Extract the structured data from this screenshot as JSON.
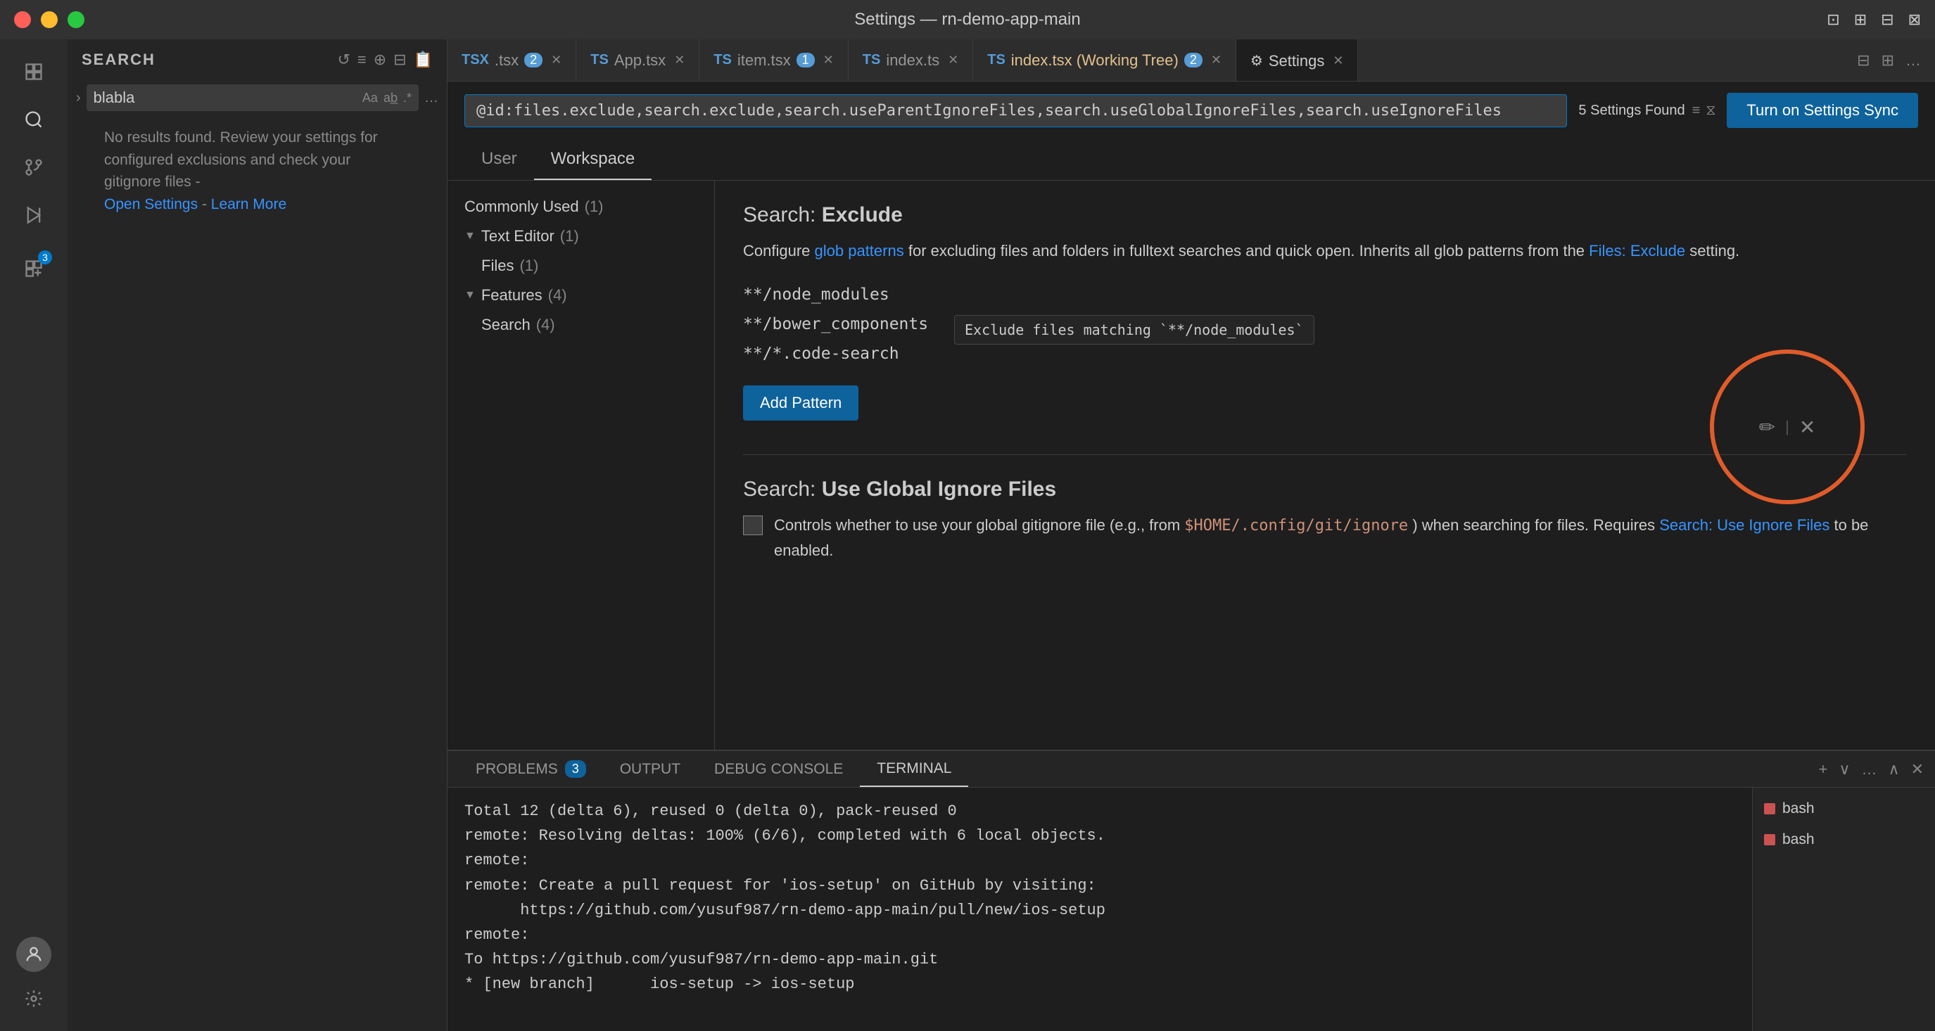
{
  "titleBar": {
    "title": "Settings — rn-demo-app-main",
    "icons": [
      "⊡",
      "⊞",
      "⊟",
      "⊠"
    ]
  },
  "activityBar": {
    "icons": [
      {
        "name": "explorer-icon",
        "symbol": "⧉",
        "active": false
      },
      {
        "name": "search-icon",
        "symbol": "🔍",
        "active": true
      },
      {
        "name": "source-control-icon",
        "symbol": "⑂",
        "active": false
      },
      {
        "name": "run-icon",
        "symbol": "▶",
        "active": false
      },
      {
        "name": "extensions-icon",
        "symbol": "⊞",
        "active": false,
        "badge": "3"
      }
    ],
    "bottomIcons": [
      {
        "name": "account-icon",
        "symbol": "👤"
      },
      {
        "name": "settings-gear-icon",
        "symbol": "⚙"
      }
    ]
  },
  "sidebar": {
    "title": "SEARCH",
    "headerIcons": [
      "↺",
      "≡",
      "⊕",
      "⊟",
      "📋"
    ],
    "searchValue": "blabla",
    "noResults": "No results found. Review your settings for configured exclusions and check your gitignore files -",
    "openSettings": "Open Settings",
    "learnMore": "Learn More",
    "chevron": "›"
  },
  "tabs": [
    {
      "label": ".tsx",
      "lang": "TSX",
      "badge": "2",
      "active": false,
      "modified": false
    },
    {
      "label": "App.tsx",
      "lang": "TS",
      "badge": null,
      "active": false,
      "modified": false
    },
    {
      "label": "item.tsx",
      "lang": "TS",
      "badge": "1",
      "active": false,
      "modified": false
    },
    {
      "label": "index.ts",
      "lang": "TS",
      "badge": null,
      "active": false,
      "modified": false
    },
    {
      "label": "index.tsx (Working Tree)",
      "lang": "TS",
      "badge": "2",
      "active": false,
      "modified": true
    },
    {
      "label": "Settings",
      "lang": null,
      "badge": null,
      "active": true,
      "modified": false
    }
  ],
  "settings": {
    "searchQuery": "@id:files.exclude,search.exclude,search.useParentIgnoreFiles,search.useGlobalIgnoreFiles,search.useIgnoreFiles",
    "foundCount": "5 Settings Found",
    "syncButton": "Turn on Settings Sync",
    "tabs": [
      {
        "label": "User",
        "active": false
      },
      {
        "label": "Workspace",
        "active": true
      }
    ],
    "tree": [
      {
        "label": "Commonly Used",
        "count": "(1)",
        "indent": 0,
        "chevron": null
      },
      {
        "label": "Text Editor",
        "count": "(1)",
        "indent": 0,
        "chevron": "▼"
      },
      {
        "label": "Files",
        "count": "(1)",
        "indent": 1,
        "chevron": null
      },
      {
        "label": "Features",
        "count": "(4)",
        "indent": 0,
        "chevron": "▼"
      },
      {
        "label": "Search",
        "count": "(4)",
        "indent": 1,
        "chevron": null
      }
    ],
    "mainSetting": {
      "title": "Search: ",
      "titleBold": "Exclude",
      "description": "Configure ",
      "descriptionLink1": "glob patterns",
      "descriptionMid": " for excluding files and folders in fulltext searches and quick open. Inherits all glob patterns from the ",
      "descriptionLink2": "Files: Exclude",
      "descriptionEnd": " setting.",
      "patterns": [
        {
          "value": "**/node_modules",
          "tooltip": "Exclude files matching `**/node_modules`",
          "showTooltip": false
        },
        {
          "value": "**/bower_components",
          "tooltip": "Exclude files matching `**/node_modules`",
          "showTooltip": true
        },
        {
          "value": "**/*.code-search",
          "tooltip": "",
          "showTooltip": false
        }
      ],
      "addButton": "Add Pattern"
    },
    "secondSetting": {
      "title": "Search: ",
      "titleBold": "Use Global Ignore Files",
      "description": "Controls whether to use your global gitignore file (e.g., from ",
      "descriptionCode": "$HOME/.config/git/ignore",
      "descriptionMid": ") when searching for files. Requires ",
      "descriptionLink": "Search: Use Ignore Files",
      "descriptionEnd": " to be enabled."
    },
    "highlightCircle": {
      "editSymbol": "✏",
      "closeSymbol": "✕"
    }
  },
  "terminal": {
    "tabs": [
      {
        "label": "PROBLEMS",
        "badge": "3",
        "active": false
      },
      {
        "label": "OUTPUT",
        "badge": null,
        "active": false
      },
      {
        "label": "DEBUG CONSOLE",
        "badge": null,
        "active": false
      },
      {
        "label": "TERMINAL",
        "badge": null,
        "active": true
      }
    ],
    "output": [
      "Total 12 (delta 6), reused 0 (delta 0), pack-reused 0",
      "remote: Resolving deltas: 100% (6/6), completed with 6 local objects.",
      "remote:",
      "remote: Create a pull request for 'ios-setup' on GitHub by visiting:",
      "remote:      https://github.com/yusuf987/rn-demo-app-main/pull/new/ios-setup",
      "remote:",
      "To https://github.com/yusuf987/rn-demo-app-main.git",
      " * [new branch]      ios-setup -> ios-setup"
    ],
    "sessions": [
      {
        "label": "bash"
      },
      {
        "label": "bash"
      }
    ],
    "icons": [
      "+",
      "∨",
      "…",
      "∧",
      "✕"
    ]
  }
}
